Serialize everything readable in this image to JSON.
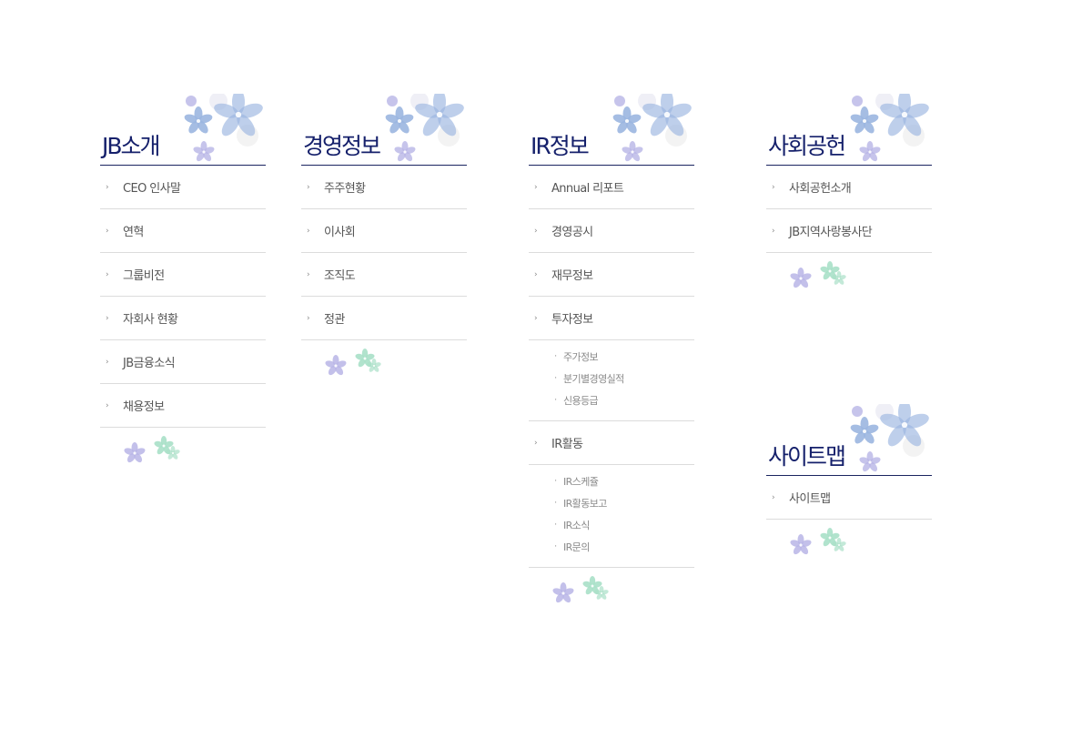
{
  "colors": {
    "title": "#15206b",
    "divider": "#1b2560",
    "item_line": "#dcdcdc",
    "flower_blue": "#9bb6e0",
    "flower_violet": "#b8b5e6",
    "flower_mint": "#a9e0c8"
  },
  "columns": [
    {
      "id": "jb-intro",
      "title": "JB소개",
      "items": [
        {
          "label": "CEO 인사말"
        },
        {
          "label": "연혁"
        },
        {
          "label": "그룹비전"
        },
        {
          "label": "자회사 현황"
        },
        {
          "label": "JB금융소식"
        },
        {
          "label": "채용정보"
        }
      ]
    },
    {
      "id": "management",
      "title": "경영정보",
      "items": [
        {
          "label": "주주현황"
        },
        {
          "label": "이사회"
        },
        {
          "label": "조직도"
        },
        {
          "label": "정관"
        }
      ]
    },
    {
      "id": "ir",
      "title": "IR정보",
      "items": [
        {
          "label": "Annual 리포트"
        },
        {
          "label": "경영공시"
        },
        {
          "label": "재무정보"
        },
        {
          "label": "투자정보",
          "sub": [
            "주가정보",
            "분기별경영실적",
            "신용등급"
          ]
        },
        {
          "label": "IR활동",
          "sub": [
            "IR스케쥴",
            "IR활동보고",
            "IR소식",
            "IR문의"
          ]
        }
      ]
    },
    {
      "id": "social",
      "title": "사회공헌",
      "items": [
        {
          "label": "사회공헌소개"
        },
        {
          "label": "JB지역사랑봉사단"
        }
      ]
    },
    {
      "id": "sitemap",
      "title": "사이트맵",
      "items": [
        {
          "label": "사이트맵"
        }
      ]
    }
  ],
  "icons": {
    "item_marker": "chevron-right-icon",
    "sub_marker": "bullet-dot-icon",
    "header_decoration": "flower-cluster-icon",
    "footer_decoration": "small-flowers-icon"
  }
}
